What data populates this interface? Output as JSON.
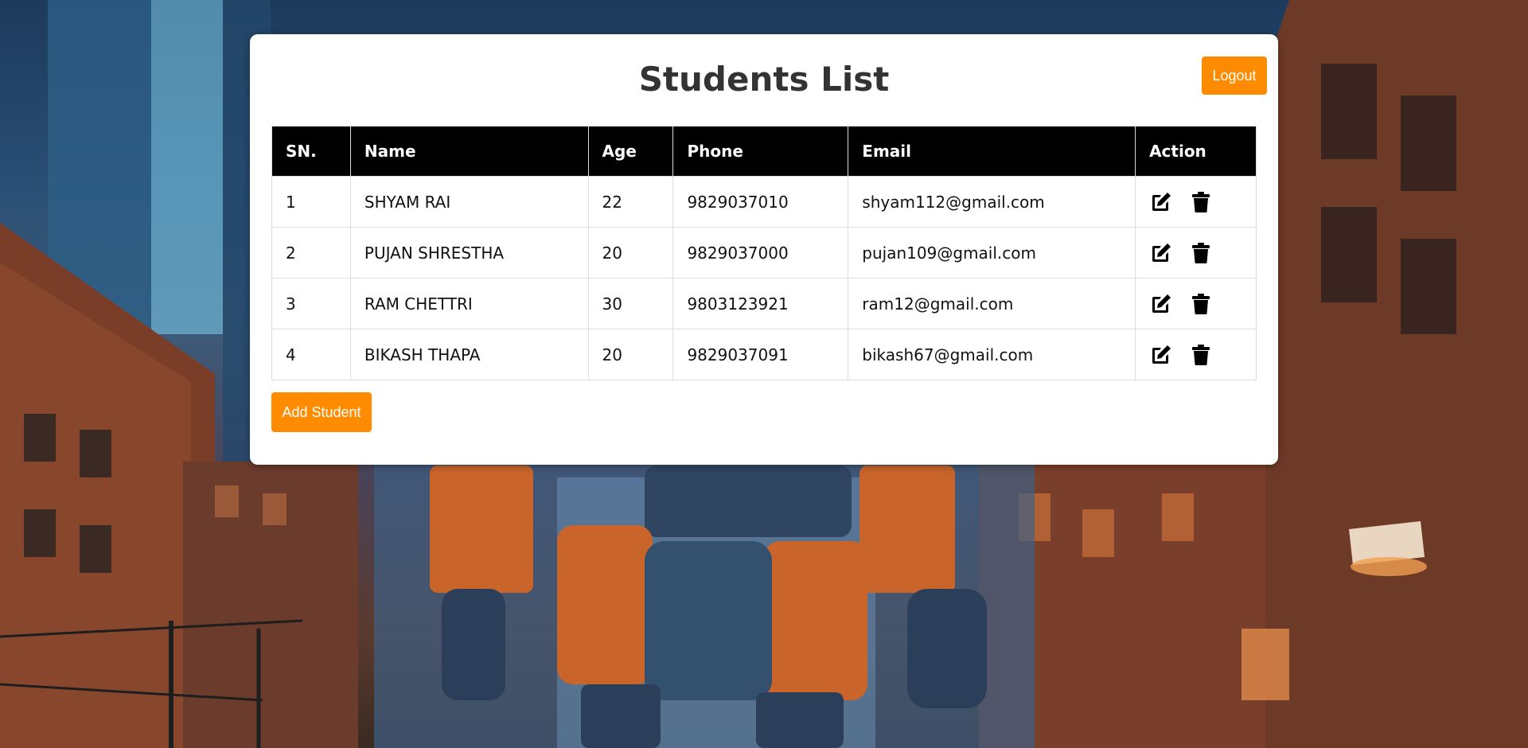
{
  "page": {
    "title": "Students List",
    "background_image": "city street with a large orange and blue robot at dusk"
  },
  "header": {
    "logout_label": "Logout"
  },
  "table": {
    "headers": [
      "SN.",
      "Name",
      "Age",
      "Phone",
      "Email",
      "Action"
    ],
    "rows": [
      {
        "sn": "1",
        "name": "SHYAM RAI",
        "age": "22",
        "phone": "9829037010",
        "email": "shyam112@gmail.com"
      },
      {
        "sn": "2",
        "name": "PUJAN SHRESTHA",
        "age": "20",
        "phone": "9829037000",
        "email": "pujan109@gmail.com"
      },
      {
        "sn": "3",
        "name": "RAM CHETTRI",
        "age": "30",
        "phone": "9803123921",
        "email": "ram12@gmail.com"
      },
      {
        "sn": "4",
        "name": "BIKASH THAPA",
        "age": "20",
        "phone": "9829037091",
        "email": "bikash67@gmail.com"
      }
    ],
    "row_actions": {
      "edit_icon": "edit-icon",
      "delete_icon": "trash-icon"
    }
  },
  "footer": {
    "add_label": "Add Student"
  },
  "colors": {
    "accent": "#ff8c00",
    "header_bg": "#000000",
    "card_bg": "#ffffff",
    "title_text": "#333333"
  }
}
